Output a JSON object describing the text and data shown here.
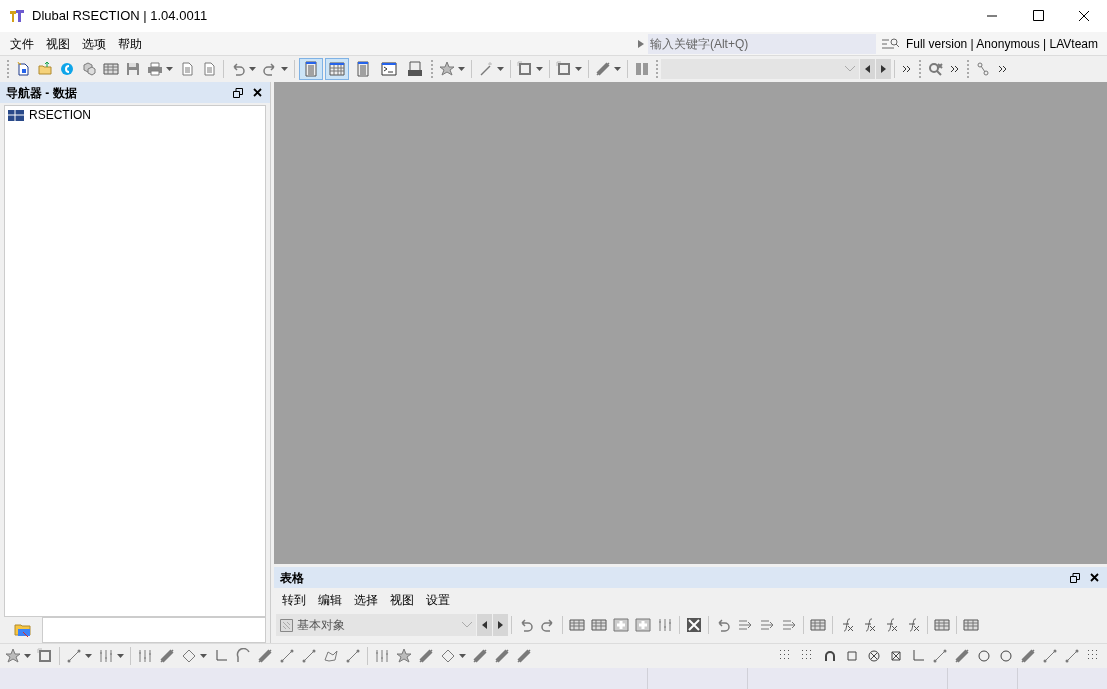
{
  "window": {
    "title": "Dlubal RSECTION | 1.04.0011"
  },
  "menu": [
    "文件",
    "视图",
    "选项",
    "帮助"
  ],
  "search": {
    "placeholder": "输入关键字(Alt+Q)"
  },
  "license": "Full version | Anonymous | LAVteam",
  "view_toggles": [
    {
      "selected": true
    },
    {
      "selected": true
    },
    {
      "selected": false
    },
    {
      "selected": false
    },
    {
      "selected": false
    }
  ],
  "navigator": {
    "title": "导航器 - 数据",
    "items": [
      {
        "label": "RSECTION",
        "selected": false
      }
    ]
  },
  "table_panel": {
    "title": "表格",
    "menu": [
      "转到",
      "编辑",
      "选择",
      "视图",
      "设置"
    ],
    "object_select": {
      "value": "基本对象"
    }
  }
}
